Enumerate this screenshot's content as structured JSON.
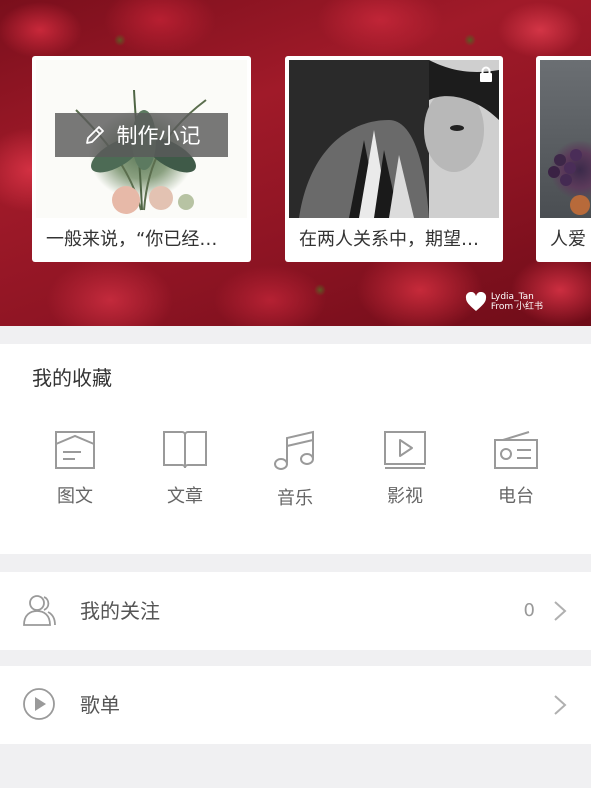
{
  "banner": {
    "cards": [
      {
        "caption": "一般来说，“你已经…",
        "action_label": "制作小记",
        "image": "flower-bouquet-image"
      },
      {
        "caption": "在两人关系中，期望…",
        "image": "couple-tattoo-image",
        "locked": true
      },
      {
        "caption": "人爱",
        "image": "grapes-figs-image"
      }
    ],
    "watermark": {
      "line1": "Lydia_Tan",
      "line2": "From 小红书"
    }
  },
  "favorites": {
    "title": "我的收藏",
    "items": [
      {
        "label": "图文",
        "icon": "image-text-icon"
      },
      {
        "label": "文章",
        "icon": "book-icon"
      },
      {
        "label": "音乐",
        "icon": "music-note-icon"
      },
      {
        "label": "影视",
        "icon": "video-play-icon"
      },
      {
        "label": "电台",
        "icon": "radio-icon"
      }
    ]
  },
  "menu": [
    {
      "label": "我的关注",
      "count": "0",
      "icon": "users-icon"
    },
    {
      "label": "歌单",
      "icon": "play-circle-icon"
    }
  ],
  "colors": {
    "banner_red": "#a01a29",
    "icon_gray": "#9a9a9a",
    "separator": "#f0f0f2"
  }
}
